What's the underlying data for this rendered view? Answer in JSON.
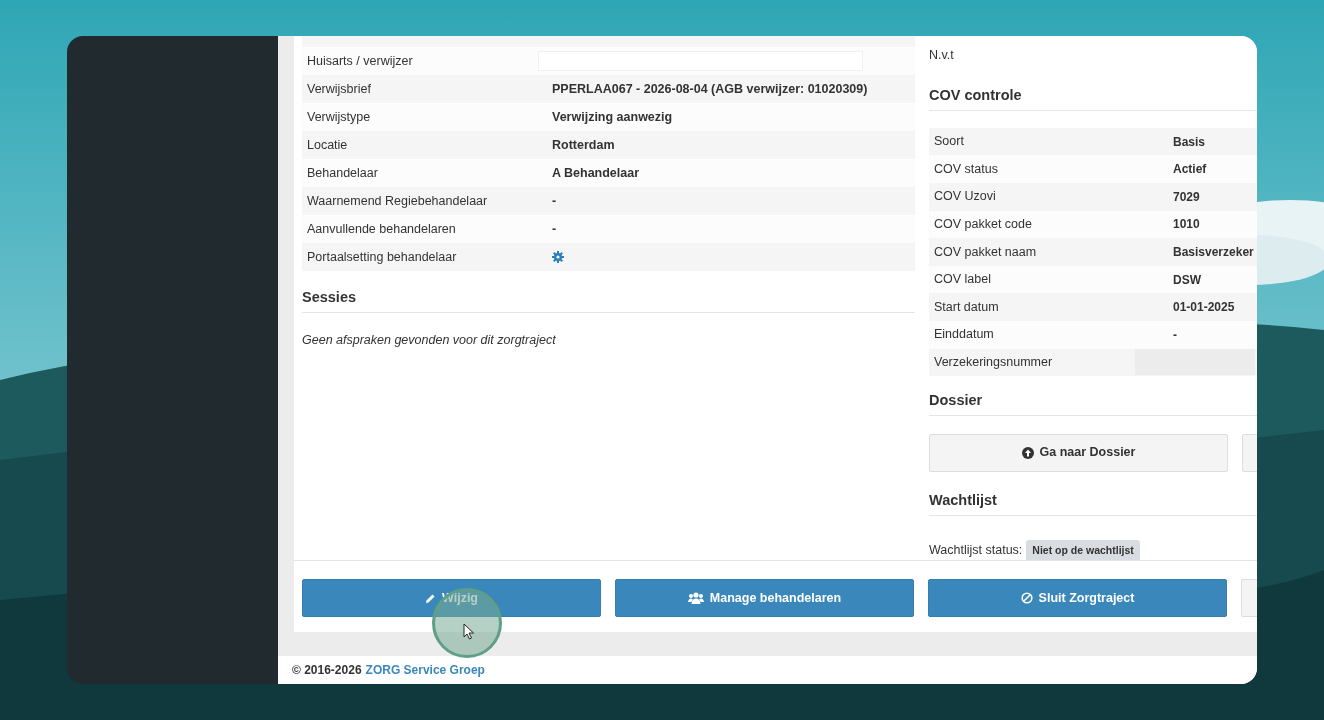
{
  "referral": {
    "rows": [
      {
        "label": "Huisarts / verwijzer",
        "kind": "redacted"
      },
      {
        "label": "Verwijsbrief",
        "kind": "text",
        "value": "PPERLAA067 - 2026-08-04 (AGB verwijzer: 01020309)"
      },
      {
        "label": "Verwijstype",
        "kind": "text",
        "value": "Verwijzing aanwezig"
      },
      {
        "label": "Locatie",
        "kind": "text",
        "value": "Rotterdam"
      },
      {
        "label": "Behandelaar",
        "kind": "text",
        "value": "A Behandelaar"
      },
      {
        "label": "Waarnemend Regiebehandelaar",
        "kind": "text",
        "value": "-"
      },
      {
        "label": "Aanvullende behandelaren",
        "kind": "text",
        "value": "-"
      },
      {
        "label": "Portaalsetting behandelaar",
        "kind": "gear"
      }
    ]
  },
  "sessions": {
    "title": "Sessies",
    "empty_text": "Geen afspraken gevonden voor dit zorgtraject"
  },
  "top_note": "N.v.t",
  "cov": {
    "title": "COV controle",
    "rows": [
      {
        "label": "Soort",
        "kind": "text",
        "value": "Basis"
      },
      {
        "label": "COV status",
        "kind": "text",
        "value": "Actief"
      },
      {
        "label": "COV Uzovi",
        "kind": "text",
        "value": "7029"
      },
      {
        "label": "COV pakket code",
        "kind": "text",
        "value": "1010"
      },
      {
        "label": "COV pakket naam",
        "kind": "text",
        "value": "Basisverzeker"
      },
      {
        "label": "COV label",
        "kind": "text",
        "value": "DSW"
      },
      {
        "label": "Start datum",
        "kind": "text",
        "value": "01-01-2025"
      },
      {
        "label": "Einddatum",
        "kind": "text",
        "value": "-"
      },
      {
        "label": "Verzekeringsnummer",
        "kind": "redacted"
      }
    ]
  },
  "dossier": {
    "title": "Dossier",
    "button": "Ga naar Dossier"
  },
  "waitlist": {
    "title": "Wachtlijst",
    "label": "Wachtlijst status:",
    "badge": "Niet op de wachtlijst"
  },
  "actions": [
    {
      "label": "Wijzig"
    },
    {
      "label": "Manage behandelaren"
    },
    {
      "label": "Sluit Zorgtraject"
    }
  ],
  "footer": {
    "copyright": "© 2016-2026",
    "link": "ZORG Service Groep"
  }
}
